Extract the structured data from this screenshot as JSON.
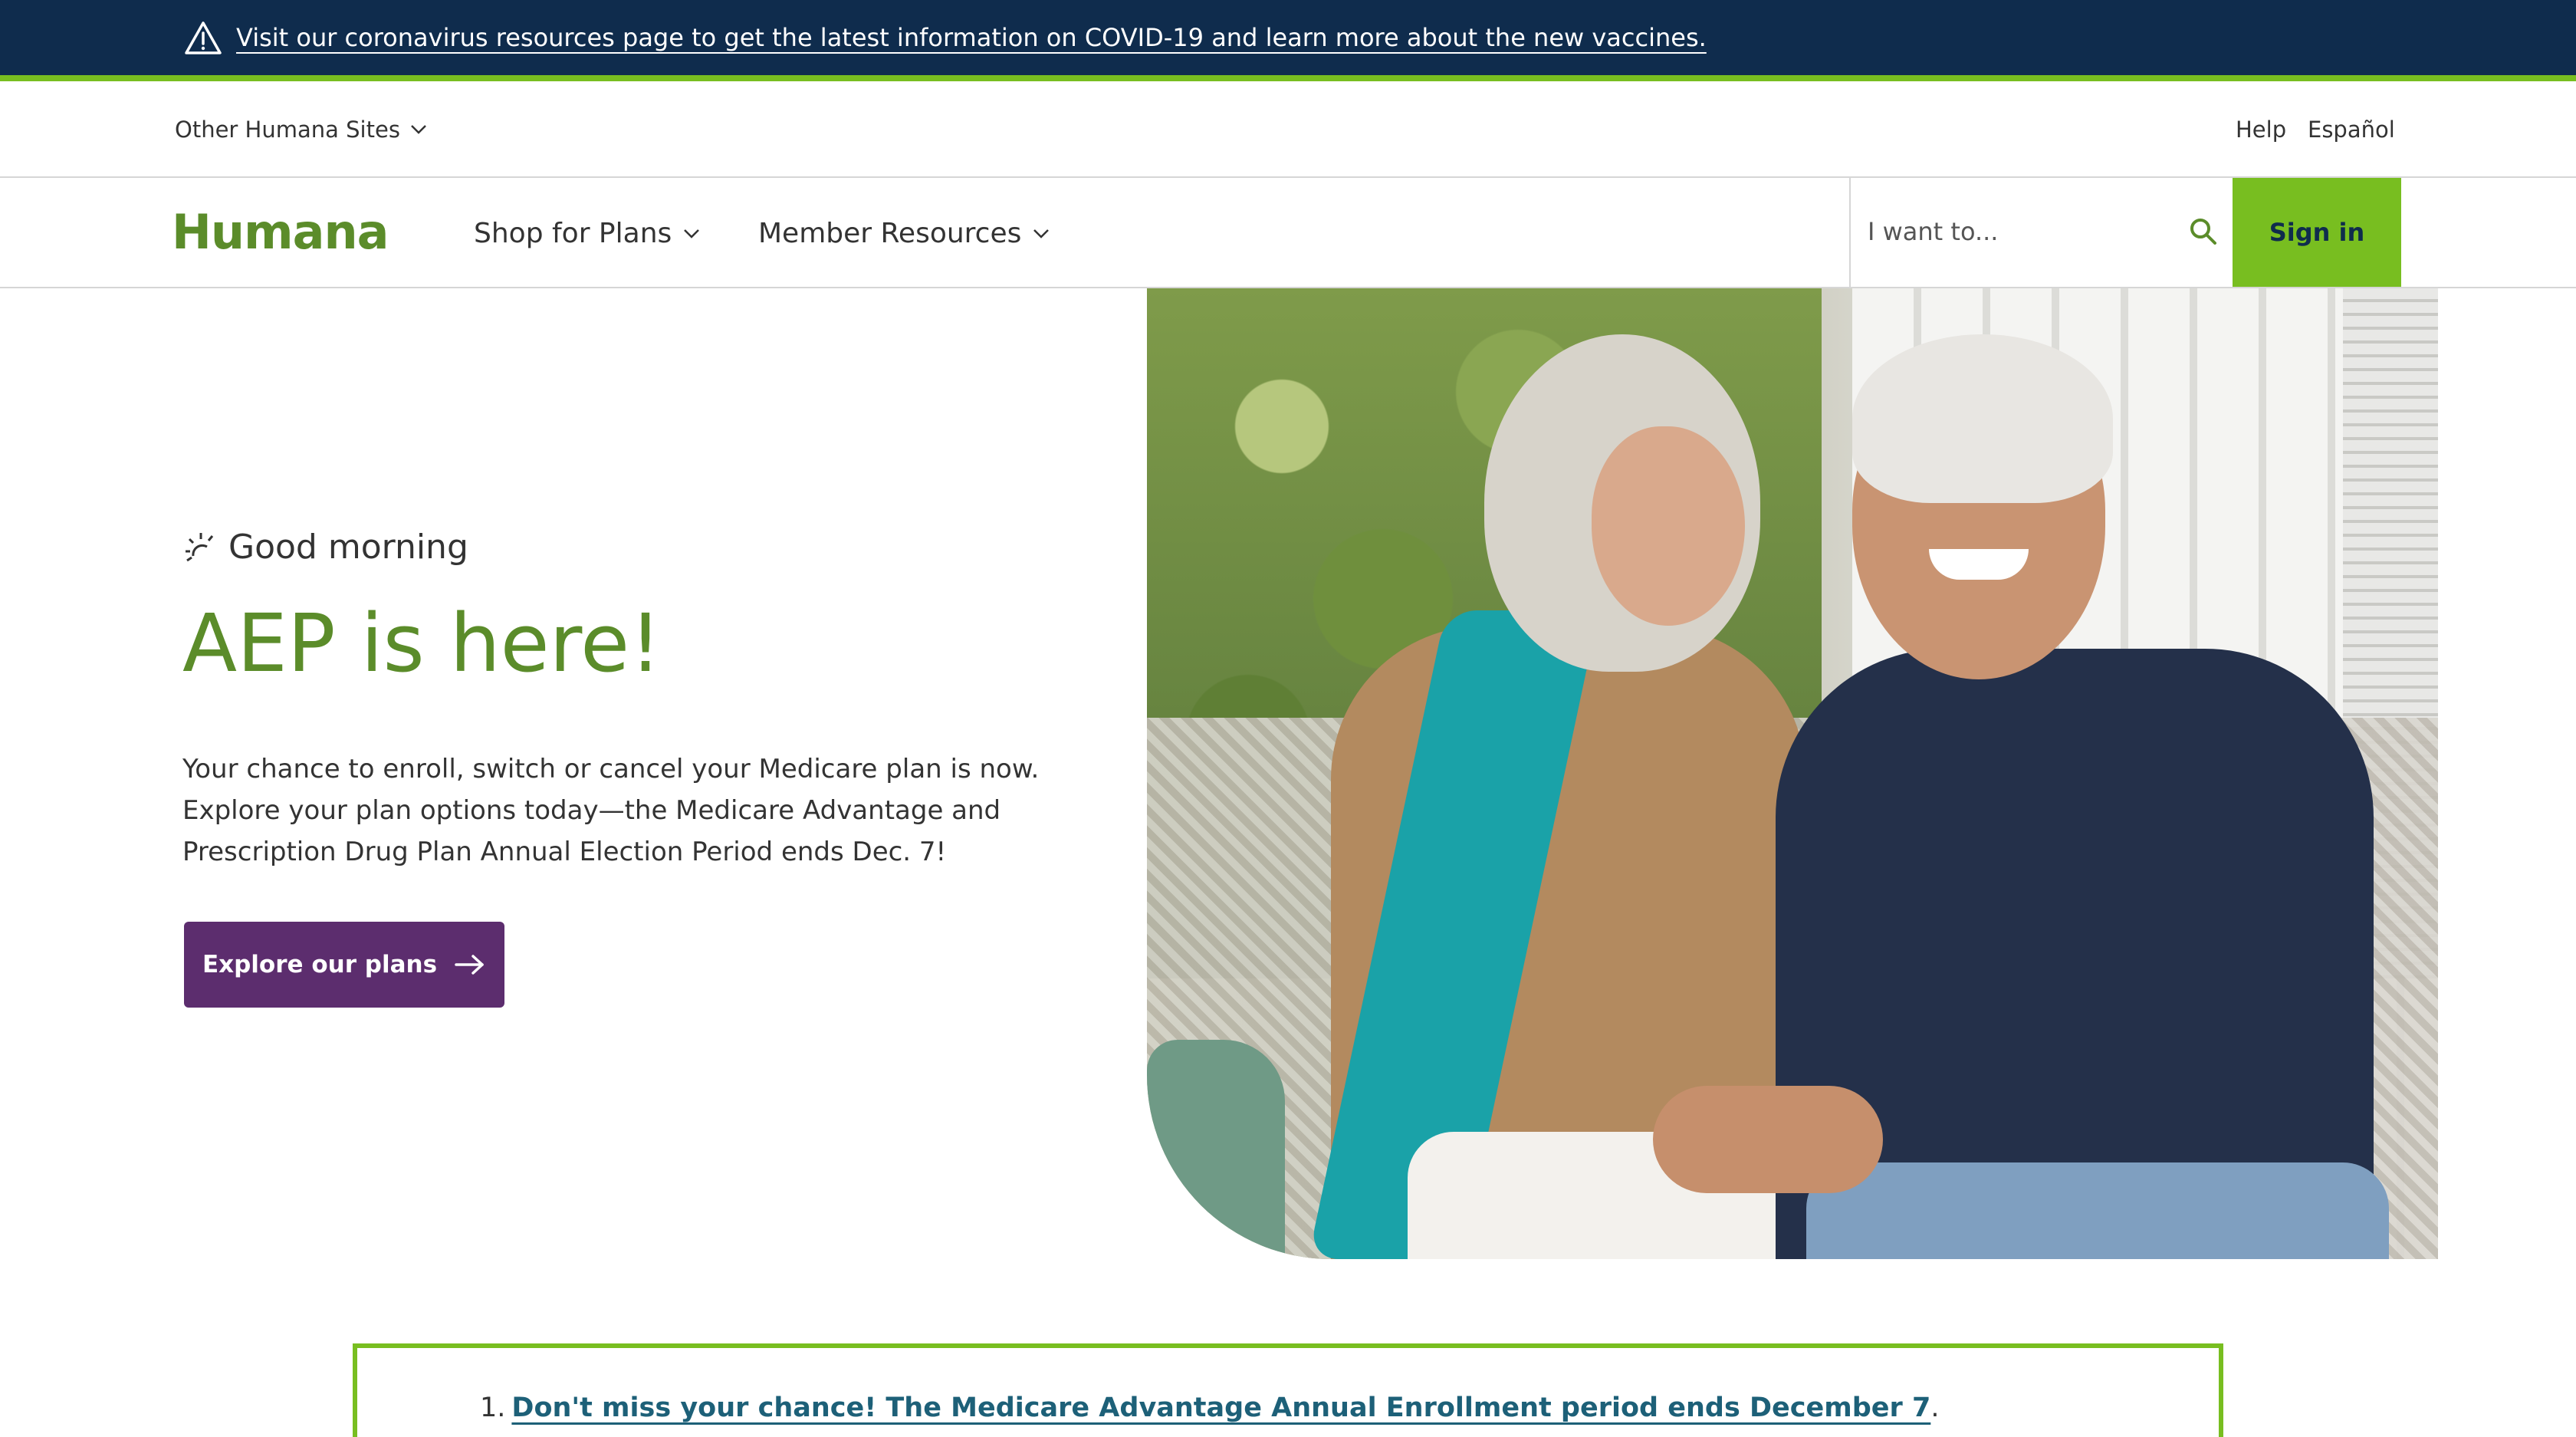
{
  "alert": {
    "icon": "warning-icon",
    "text": "Visit our coronavirus resources page to get the latest information on COVID-19 and learn more about the new vaccines."
  },
  "utility": {
    "other_sites": "Other Humana Sites",
    "help": "Help",
    "espanol": "Español"
  },
  "nav": {
    "logo": "Humana",
    "shop": "Shop for Plans",
    "member": "Member Resources",
    "search_placeholder": "I want to...",
    "sign_in": "Sign in"
  },
  "hero": {
    "greeting": "Good morning",
    "title": "AEP is here!",
    "body": "Your chance to enroll, switch or cancel your Medicare plan is now. Explore your plan options today—the Medicare Advantage and Prescription Drug Plan Annual Election Period ends Dec. 7!",
    "cta": "Explore our plans"
  },
  "notice": {
    "number": "1.",
    "link": "Don't miss your chance! The Medicare Advantage Annual Enrollment period ends December 7",
    "suffix": "."
  },
  "colors": {
    "brand_green": "#78be20",
    "logo_green": "#5b8c2a",
    "navy": "#0f2c4d",
    "purple": "#5c2d6e",
    "link_teal": "#1d6078"
  }
}
